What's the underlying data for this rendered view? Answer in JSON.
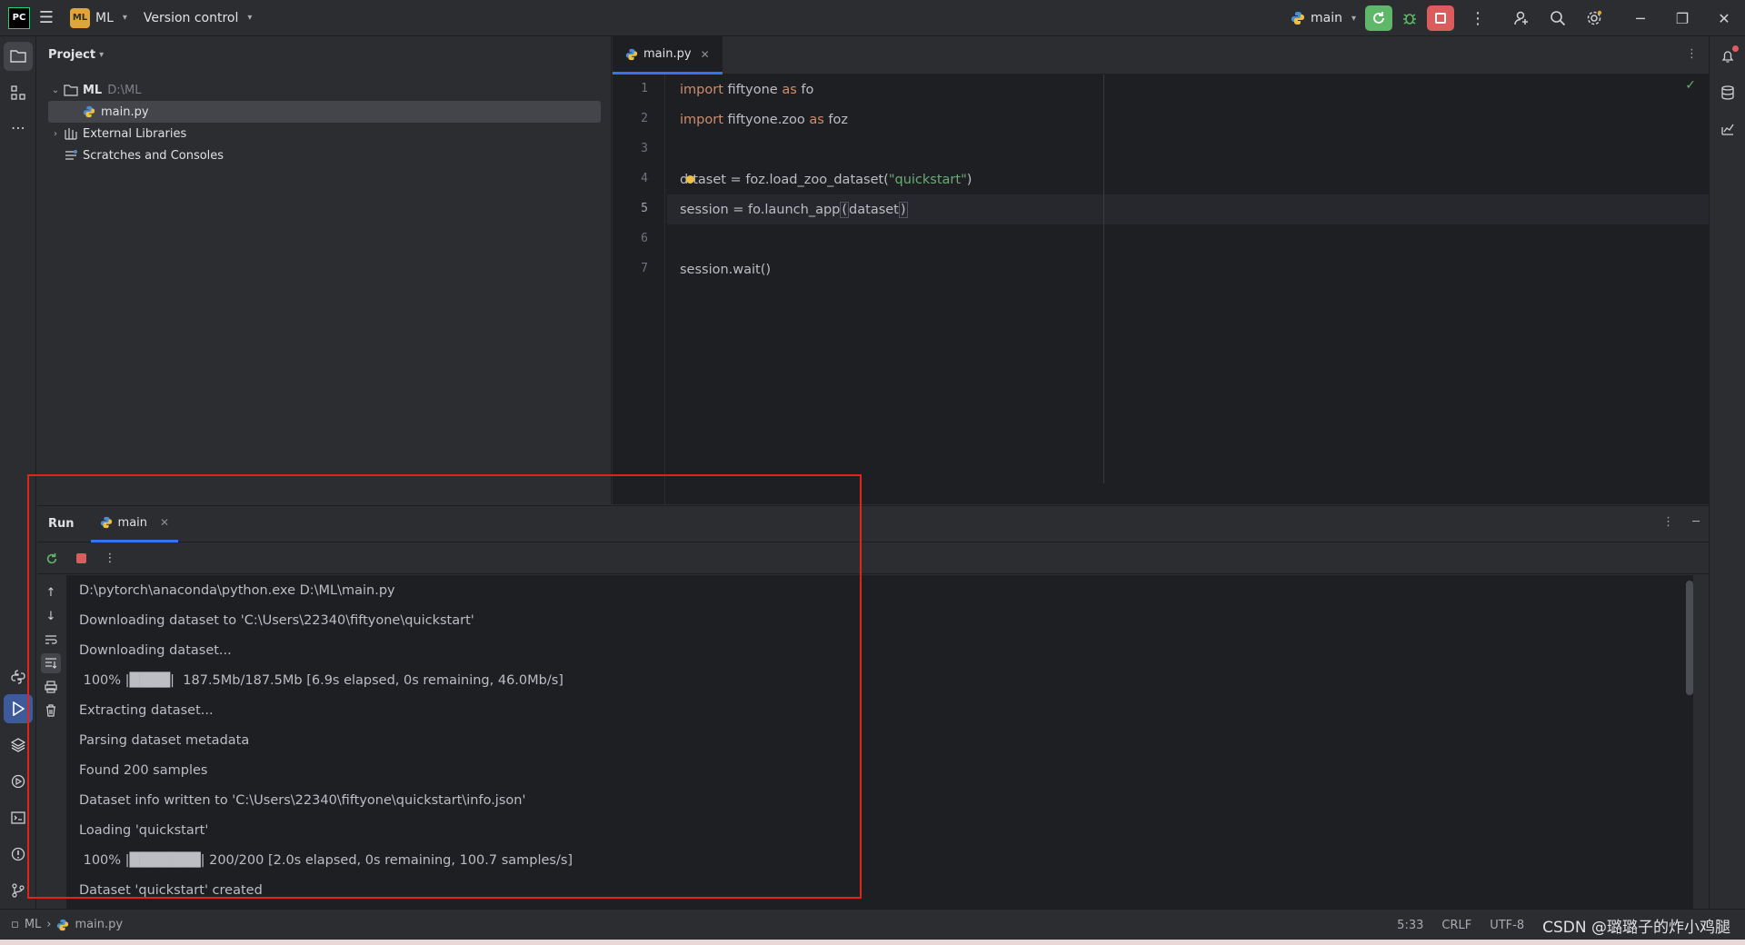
{
  "titlebar": {
    "logo": "PC",
    "project_badge": "ML",
    "project_name": "ML",
    "vcs_label": "Version control",
    "run_config": "main"
  },
  "project_panel": {
    "title": "Project",
    "tree": {
      "root_name": "ML",
      "root_path": "D:\\ML",
      "file": "main.py",
      "external": "External Libraries",
      "scratches": "Scratches and Consoles"
    }
  },
  "editor": {
    "tab_label": "main.py",
    "current_line": 5,
    "line_numbers": [
      "1",
      "2",
      "3",
      "4",
      "5",
      "6",
      "7"
    ],
    "code": {
      "l1_kw": "import",
      "l1_mod": " fiftyone ",
      "l1_as": "as",
      "l1_alias": " fo",
      "l2_kw": "import",
      "l2_mod": " fiftyone.zoo ",
      "l2_as": "as",
      "l2_alias": " foz",
      "l4_pre": "d",
      "l4_rest": "taset = foz.load_zoo_dataset(",
      "l4_str": "\"quickstart\"",
      "l4_end": ")",
      "l5_pre": "session = fo.launch_app",
      "l5_paren": "(",
      "l5_arg": "dataset",
      "l5_end": ")",
      "l7": "session.wait()"
    }
  },
  "run_panel": {
    "title": "Run",
    "tab_label": "main",
    "console_lines": [
      "D:\\pytorch\\anaconda\\python.exe D:\\ML\\main.py",
      "Downloading dataset to 'C:\\Users\\22340\\fiftyone\\quickstart'",
      "Downloading dataset...",
      " 100% |████|  187.5Mb/187.5Mb [6.9s elapsed, 0s remaining, 46.0Mb/s]",
      "Extracting dataset...",
      "Parsing dataset metadata",
      "Found 200 samples",
      "Dataset info written to 'C:\\Users\\22340\\fiftyone\\quickstart\\info.json'",
      "Loading 'quickstart'",
      " 100% |███████| 200/200 [2.0s elapsed, 0s remaining, 100.7 samples/s]",
      "Dataset 'quickstart' created"
    ]
  },
  "statusbar": {
    "project": "ML",
    "file": "main.py",
    "position": "5:33",
    "line_ending": "CRLF",
    "encoding": "UTF-8",
    "watermark": "CSDN @璐璐子的炸小鸡腿"
  },
  "colors": {
    "accent": "#3574f0",
    "run_green": "#5fb86a",
    "stop_red": "#db5c5c",
    "highlight_red": "#e2231a"
  }
}
